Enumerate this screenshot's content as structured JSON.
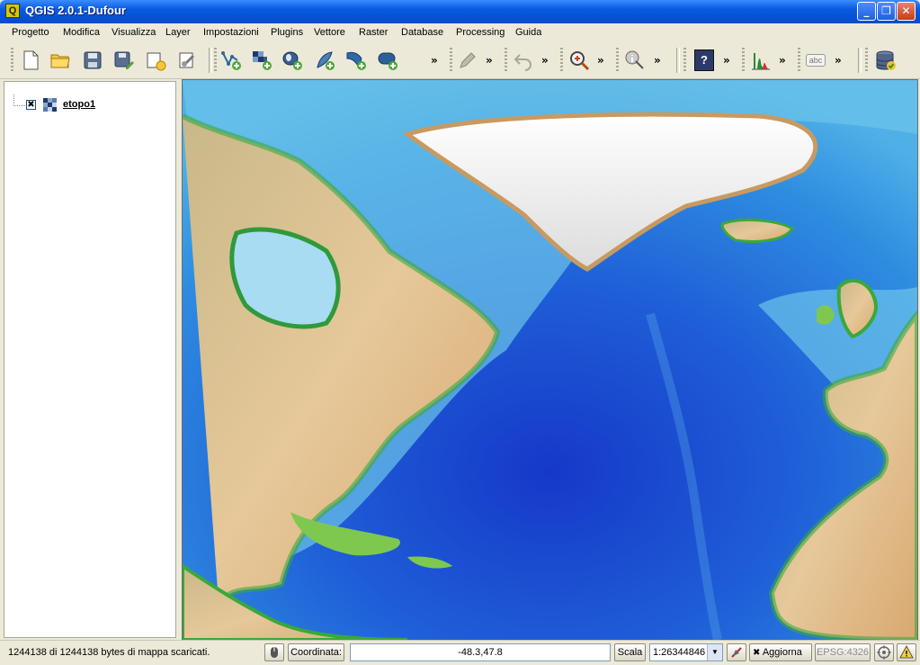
{
  "window": {
    "title": "QGIS 2.0.1-Dufour",
    "app_icon_glyph": "Q",
    "controls": {
      "minimize": "_",
      "maximize": "❐",
      "close": "✕"
    }
  },
  "menu": [
    "Progetto",
    "Modifica",
    "Visualizza",
    "Layer",
    "Impostazioni",
    "Plugins",
    "Vettore",
    "Raster",
    "Database",
    "Processing",
    "Guida"
  ],
  "toolbar": {
    "overflow_glyph": "»",
    "icons": [
      "new-project-icon",
      "open-project-icon",
      "save-project-icon",
      "save-as-icon",
      "new-print-composer-icon",
      "composer-manager-icon",
      "add-vector-layer-icon",
      "add-raster-layer-icon",
      "add-postgis-layer-icon",
      "add-spatialite-layer-icon",
      "add-wms-layer-icon",
      "add-wcs-layer-icon",
      "digitize-pencil-icon",
      "undo-icon",
      "zoom-pan-icon",
      "identify-icon",
      "help-icon",
      "histogram-icon",
      "label-icon",
      "database-icon"
    ],
    "label_icon_text": "abc",
    "help_icon_text": "?"
  },
  "layers": {
    "items": [
      {
        "name": "etopo1",
        "visible": true,
        "check_glyph": "✖",
        "type": "raster-icon"
      }
    ]
  },
  "status": {
    "message": "1244138 di 1244138 bytes di mappa scaricati.",
    "coord_label": "Coordinata:",
    "coord_value": "-48.3,47.8",
    "scale_label": "Scala",
    "scale_value": "1:26344846",
    "render_glyph": "✖",
    "render_label": "Aggiorna",
    "crs": "EPSG:4326",
    "colors": {
      "crs_text": "#8a8a8a"
    }
  }
}
